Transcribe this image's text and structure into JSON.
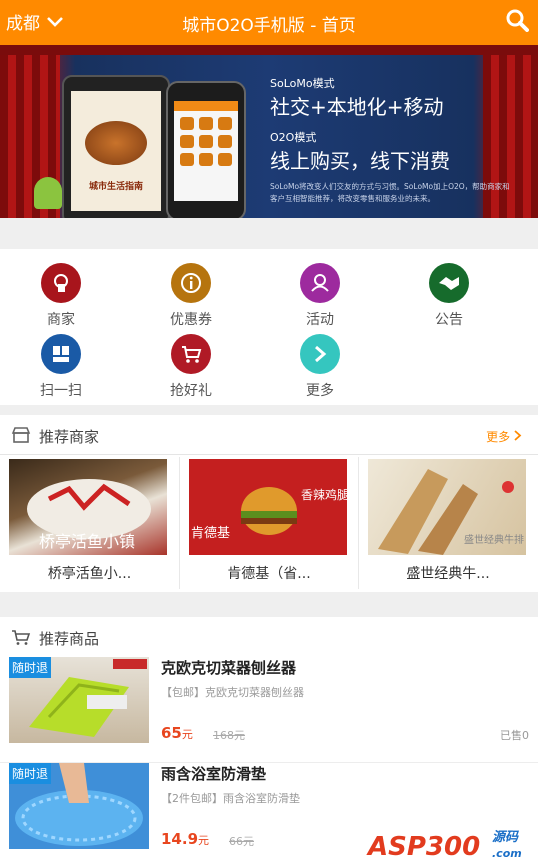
{
  "header": {
    "city": "成都",
    "title": "城市O2O手机版 - 首页"
  },
  "banner": {
    "line1": "SoLoMo模式",
    "line2": "社交+本地化+移动",
    "line3": "O2O模式",
    "line4": "线上购买，线下消费",
    "desc": "SoLoMo将改变人们交友的方式与习惯。SoLoMo加上O2O，帮助商家和客户互相智能推荐，将改变零售和服务业的未来。",
    "phone_label": "城市生活指南"
  },
  "categories": [
    {
      "label": "商家",
      "color": "#a8151c",
      "icon": "store-icon"
    },
    {
      "label": "优惠券",
      "color": "#b6740e",
      "icon": "coupon-icon"
    },
    {
      "label": "活动",
      "color": "#9d2a9e",
      "icon": "activity-icon"
    },
    {
      "label": "公告",
      "color": "#166b2c",
      "icon": "announcement-icon"
    },
    {
      "label": "扫一扫",
      "color": "#1a5aa6",
      "icon": "scan-icon"
    },
    {
      "label": "抢好礼",
      "color": "#b01a26",
      "icon": "cart-icon"
    },
    {
      "label": "更多",
      "color": "#35c6bf",
      "icon": "more-icon"
    }
  ],
  "merchants_section": {
    "title": "推荐商家",
    "more": "更多"
  },
  "merchants": [
    {
      "name": "桥亭活鱼小...",
      "img_text": "桥亭活鱼小镇"
    },
    {
      "name": "肯德基（省...",
      "img_text1": "肯德基",
      "img_text2": "香辣鸡腿堡"
    },
    {
      "name": "盛世经典牛...",
      "img_text": "盛世经典牛排"
    }
  ],
  "products_section": {
    "title": "推荐商品"
  },
  "products": [
    {
      "tag": "随时退",
      "name": "克欧克切菜器刨丝器",
      "desc": "【包邮】克欧克切菜器刨丝器",
      "price": "65",
      "unit": "元",
      "old_price": "168元",
      "sold": "已售0"
    },
    {
      "tag": "随时退",
      "name": "雨含浴室防滑垫",
      "desc": "【2件包邮】雨含浴室防滑垫",
      "price": "14.9",
      "unit": "元",
      "old_price": "66元"
    }
  ],
  "watermark": {
    "text1": "ASP300",
    "text2": "源码",
    "text3": ".com"
  }
}
